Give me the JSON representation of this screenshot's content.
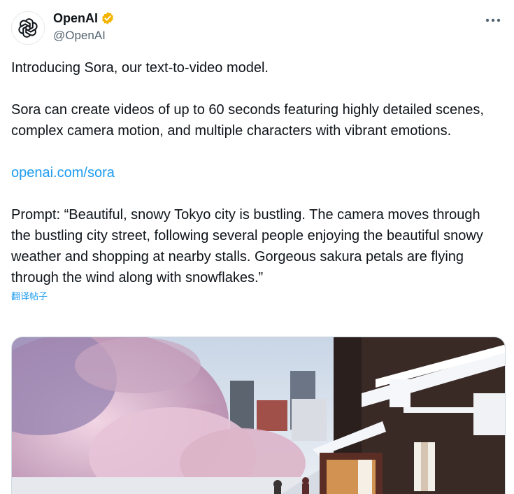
{
  "author": {
    "display_name": "OpenAI",
    "handle": "@OpenAI",
    "avatar_icon": "openai-logo-icon",
    "verified_icon": "verified-badge-icon",
    "verified_color": "#f4b400"
  },
  "tweet": {
    "intro": "Introducing Sora, our text-to-video model.",
    "description": "Sora can create videos of up to 60 seconds featuring highly detailed scenes, complex camera motion, and multiple characters with vibrant emotions.",
    "link_text": "openai.com/sora",
    "prompt": "Prompt: “Beautiful, snowy Tokyo city is bustling. The camera moves through the bustling city street, following several people enjoying the beautiful snowy weather and shopping at nearby stalls. Gorgeous sakura petals are flying through the wind along with snowflakes.”",
    "translate_label": "翻译帖子"
  },
  "ui": {
    "more_icon": "more-options-icon",
    "link_color": "#1d9bf0",
    "text_color": "#0f1419",
    "secondary_color": "#536471"
  },
  "media": {
    "type": "video-thumbnail"
  }
}
